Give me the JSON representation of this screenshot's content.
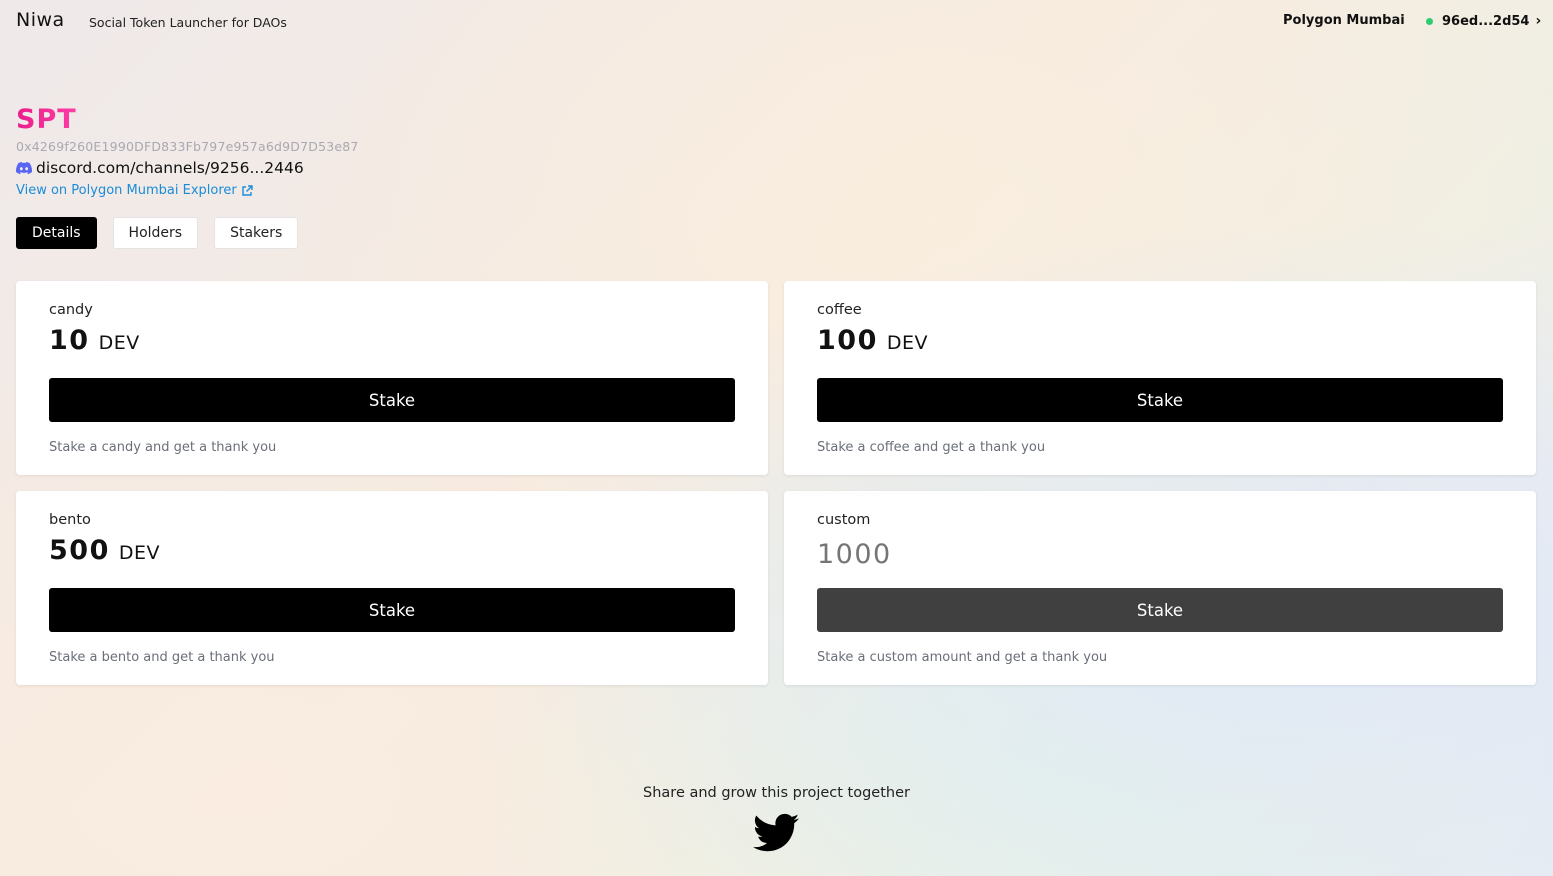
{
  "header": {
    "brand": "Niwa",
    "tagline": "Social Token Launcher for DAOs",
    "network": "Polygon Mumbai",
    "wallet": "96ed...2d54",
    "wallet_status_color": "#2ecc71"
  },
  "token": {
    "symbol": "SPT",
    "address": "0x4269f260E1990DFD833Fb797e957a6d9D7D53e87",
    "discord": "discord.com/channels/9256...2446",
    "explorer_link": "View on Polygon Mumbai Explorer"
  },
  "tabs": [
    {
      "label": "Details",
      "active": true
    },
    {
      "label": "Holders",
      "active": false
    },
    {
      "label": "Stakers",
      "active": false
    }
  ],
  "cards": [
    {
      "name": "candy",
      "amount": "10",
      "unit": "DEV",
      "button": "Stake",
      "description": "Stake a candy and get a thank you"
    },
    {
      "name": "coffee",
      "amount": "100",
      "unit": "DEV",
      "button": "Stake",
      "description": "Stake a coffee and get a thank you"
    },
    {
      "name": "bento",
      "amount": "500",
      "unit": "DEV",
      "button": "Stake",
      "description": "Stake a bento and get a thank you"
    },
    {
      "name": "custom",
      "placeholder": "1000",
      "button": "Stake",
      "description": "Stake a custom amount and get a thank you"
    }
  ],
  "footer": {
    "share_text": "Share and grow this project together",
    "icon": "twitter-icon"
  },
  "colors": {
    "accent_pink": "#e91e8c",
    "link_blue": "#1a8cd8",
    "button_black": "#000000",
    "button_disabled": "#404040"
  }
}
